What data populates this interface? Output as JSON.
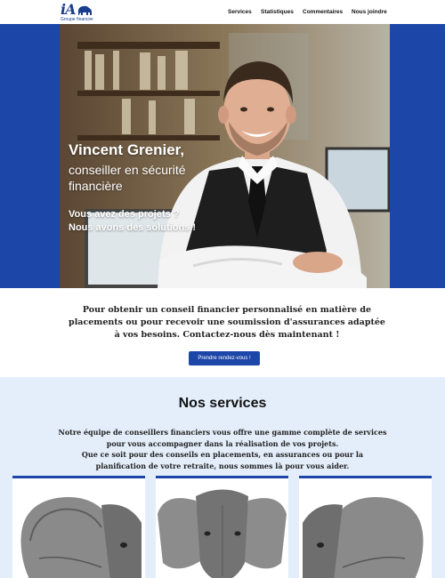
{
  "header": {
    "logo_text": "iA",
    "logo_subtitle": "Groupe financier",
    "nav": [
      "Services",
      "Statistiques",
      "Commentaires",
      "Nous joindre"
    ]
  },
  "hero": {
    "name": "Vincent Grenier,",
    "role": "conseiller en sécurité financière",
    "tagline": "Vous avez des projets ? Nous avons des solutions !"
  },
  "intro": {
    "text": "Pour obtenir un conseil financier personnalisé en matière de placements ou pour recevoir une soumission d'assurances adaptée à vos besoins. Contactez-nous dès maintenant !",
    "cta": "Prendre rendez-vous !"
  },
  "services": {
    "title": "Nos services",
    "text_1": "Notre équipe de conseillers financiers vous offre une gamme complète de services pour vous accompagner dans la réalisation de vos projets.",
    "text_2": "Que ce soit pour des conseils en placements, en assurances ou pour la planification de votre retraite, nous sommes là pour vous aider."
  },
  "colors": {
    "brand_blue": "#1c46a8",
    "services_bg": "#e4eefb"
  }
}
